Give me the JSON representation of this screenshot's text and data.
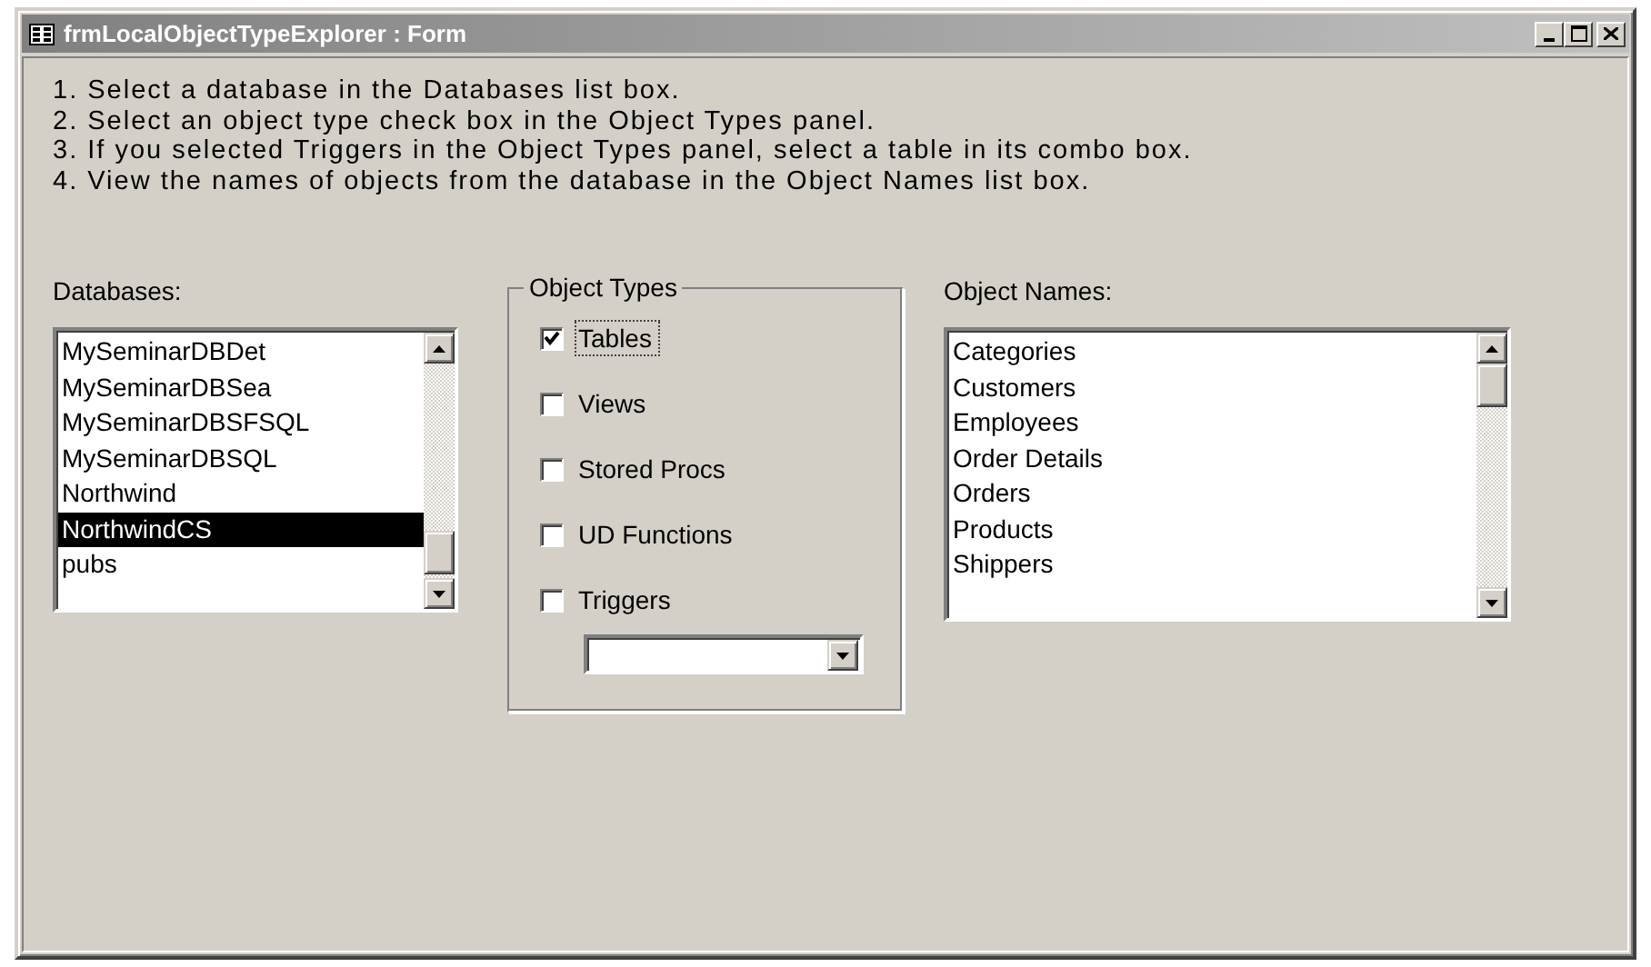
{
  "window": {
    "title": "frmLocalObjectTypeExplorer : Form"
  },
  "instructions": [
    "1. Select a database in the Databases list box.",
    "2. Select an object type check box in the Object Types panel.",
    "3. If you selected Triggers in the Object Types panel, select a table in its combo box.",
    "4. View the names of objects from the database in the Object Names list box."
  ],
  "databases": {
    "label": "Databases:",
    "items": [
      {
        "text": "MySeminarDBDet",
        "selected": false
      },
      {
        "text": "MySeminarDBSea",
        "selected": false
      },
      {
        "text": "MySeminarDBSFSQL",
        "selected": false
      },
      {
        "text": "MySeminarDBSQL",
        "selected": false
      },
      {
        "text": "Northwind",
        "selected": false
      },
      {
        "text": "NorthwindCS",
        "selected": true
      },
      {
        "text": "pubs",
        "selected": false
      }
    ]
  },
  "object_types": {
    "title": "Object Types",
    "items": [
      {
        "label": "Tables",
        "checked": true,
        "focused": true
      },
      {
        "label": "Views",
        "checked": false,
        "focused": false
      },
      {
        "label": "Stored Procs",
        "checked": false,
        "focused": false
      },
      {
        "label": "UD Functions",
        "checked": false,
        "focused": false
      },
      {
        "label": "Triggers",
        "checked": false,
        "focused": false
      }
    ]
  },
  "object_names": {
    "label": "Object Names:",
    "items": [
      {
        "text": "Categories",
        "selected": false
      },
      {
        "text": "Customers",
        "selected": false
      },
      {
        "text": "Employees",
        "selected": false
      },
      {
        "text": "Order Details",
        "selected": false
      },
      {
        "text": "Orders",
        "selected": false
      },
      {
        "text": "Products",
        "selected": false
      },
      {
        "text": "Shippers",
        "selected": false
      }
    ]
  }
}
